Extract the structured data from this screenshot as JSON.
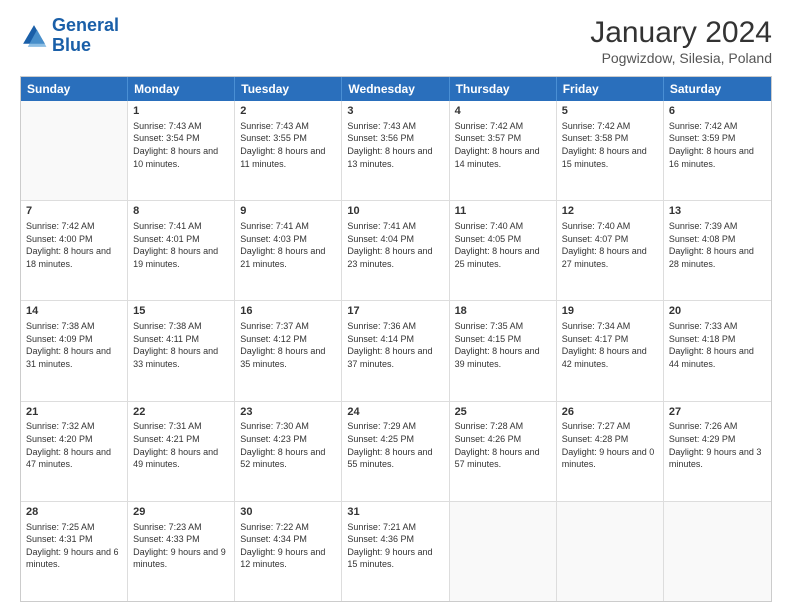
{
  "logo": {
    "line1": "General",
    "line2": "Blue"
  },
  "title": "January 2024",
  "subtitle": "Pogwizdow, Silesia, Poland",
  "header_days": [
    "Sunday",
    "Monday",
    "Tuesday",
    "Wednesday",
    "Thursday",
    "Friday",
    "Saturday"
  ],
  "weeks": [
    [
      {
        "day": "",
        "empty": true
      },
      {
        "day": "1",
        "sunrise": "Sunrise: 7:43 AM",
        "sunset": "Sunset: 3:54 PM",
        "daylight": "Daylight: 8 hours and 10 minutes."
      },
      {
        "day": "2",
        "sunrise": "Sunrise: 7:43 AM",
        "sunset": "Sunset: 3:55 PM",
        "daylight": "Daylight: 8 hours and 11 minutes."
      },
      {
        "day": "3",
        "sunrise": "Sunrise: 7:43 AM",
        "sunset": "Sunset: 3:56 PM",
        "daylight": "Daylight: 8 hours and 13 minutes."
      },
      {
        "day": "4",
        "sunrise": "Sunrise: 7:42 AM",
        "sunset": "Sunset: 3:57 PM",
        "daylight": "Daylight: 8 hours and 14 minutes."
      },
      {
        "day": "5",
        "sunrise": "Sunrise: 7:42 AM",
        "sunset": "Sunset: 3:58 PM",
        "daylight": "Daylight: 8 hours and 15 minutes."
      },
      {
        "day": "6",
        "sunrise": "Sunrise: 7:42 AM",
        "sunset": "Sunset: 3:59 PM",
        "daylight": "Daylight: 8 hours and 16 minutes."
      }
    ],
    [
      {
        "day": "7",
        "sunrise": "Sunrise: 7:42 AM",
        "sunset": "Sunset: 4:00 PM",
        "daylight": "Daylight: 8 hours and 18 minutes."
      },
      {
        "day": "8",
        "sunrise": "Sunrise: 7:41 AM",
        "sunset": "Sunset: 4:01 PM",
        "daylight": "Daylight: 8 hours and 19 minutes."
      },
      {
        "day": "9",
        "sunrise": "Sunrise: 7:41 AM",
        "sunset": "Sunset: 4:03 PM",
        "daylight": "Daylight: 8 hours and 21 minutes."
      },
      {
        "day": "10",
        "sunrise": "Sunrise: 7:41 AM",
        "sunset": "Sunset: 4:04 PM",
        "daylight": "Daylight: 8 hours and 23 minutes."
      },
      {
        "day": "11",
        "sunrise": "Sunrise: 7:40 AM",
        "sunset": "Sunset: 4:05 PM",
        "daylight": "Daylight: 8 hours and 25 minutes."
      },
      {
        "day": "12",
        "sunrise": "Sunrise: 7:40 AM",
        "sunset": "Sunset: 4:07 PM",
        "daylight": "Daylight: 8 hours and 27 minutes."
      },
      {
        "day": "13",
        "sunrise": "Sunrise: 7:39 AM",
        "sunset": "Sunset: 4:08 PM",
        "daylight": "Daylight: 8 hours and 28 minutes."
      }
    ],
    [
      {
        "day": "14",
        "sunrise": "Sunrise: 7:38 AM",
        "sunset": "Sunset: 4:09 PM",
        "daylight": "Daylight: 8 hours and 31 minutes."
      },
      {
        "day": "15",
        "sunrise": "Sunrise: 7:38 AM",
        "sunset": "Sunset: 4:11 PM",
        "daylight": "Daylight: 8 hours and 33 minutes."
      },
      {
        "day": "16",
        "sunrise": "Sunrise: 7:37 AM",
        "sunset": "Sunset: 4:12 PM",
        "daylight": "Daylight: 8 hours and 35 minutes."
      },
      {
        "day": "17",
        "sunrise": "Sunrise: 7:36 AM",
        "sunset": "Sunset: 4:14 PM",
        "daylight": "Daylight: 8 hours and 37 minutes."
      },
      {
        "day": "18",
        "sunrise": "Sunrise: 7:35 AM",
        "sunset": "Sunset: 4:15 PM",
        "daylight": "Daylight: 8 hours and 39 minutes."
      },
      {
        "day": "19",
        "sunrise": "Sunrise: 7:34 AM",
        "sunset": "Sunset: 4:17 PM",
        "daylight": "Daylight: 8 hours and 42 minutes."
      },
      {
        "day": "20",
        "sunrise": "Sunrise: 7:33 AM",
        "sunset": "Sunset: 4:18 PM",
        "daylight": "Daylight: 8 hours and 44 minutes."
      }
    ],
    [
      {
        "day": "21",
        "sunrise": "Sunrise: 7:32 AM",
        "sunset": "Sunset: 4:20 PM",
        "daylight": "Daylight: 8 hours and 47 minutes."
      },
      {
        "day": "22",
        "sunrise": "Sunrise: 7:31 AM",
        "sunset": "Sunset: 4:21 PM",
        "daylight": "Daylight: 8 hours and 49 minutes."
      },
      {
        "day": "23",
        "sunrise": "Sunrise: 7:30 AM",
        "sunset": "Sunset: 4:23 PM",
        "daylight": "Daylight: 8 hours and 52 minutes."
      },
      {
        "day": "24",
        "sunrise": "Sunrise: 7:29 AM",
        "sunset": "Sunset: 4:25 PM",
        "daylight": "Daylight: 8 hours and 55 minutes."
      },
      {
        "day": "25",
        "sunrise": "Sunrise: 7:28 AM",
        "sunset": "Sunset: 4:26 PM",
        "daylight": "Daylight: 8 hours and 57 minutes."
      },
      {
        "day": "26",
        "sunrise": "Sunrise: 7:27 AM",
        "sunset": "Sunset: 4:28 PM",
        "daylight": "Daylight: 9 hours and 0 minutes."
      },
      {
        "day": "27",
        "sunrise": "Sunrise: 7:26 AM",
        "sunset": "Sunset: 4:29 PM",
        "daylight": "Daylight: 9 hours and 3 minutes."
      }
    ],
    [
      {
        "day": "28",
        "sunrise": "Sunrise: 7:25 AM",
        "sunset": "Sunset: 4:31 PM",
        "daylight": "Daylight: 9 hours and 6 minutes."
      },
      {
        "day": "29",
        "sunrise": "Sunrise: 7:23 AM",
        "sunset": "Sunset: 4:33 PM",
        "daylight": "Daylight: 9 hours and 9 minutes."
      },
      {
        "day": "30",
        "sunrise": "Sunrise: 7:22 AM",
        "sunset": "Sunset: 4:34 PM",
        "daylight": "Daylight: 9 hours and 12 minutes."
      },
      {
        "day": "31",
        "sunrise": "Sunrise: 7:21 AM",
        "sunset": "Sunset: 4:36 PM",
        "daylight": "Daylight: 9 hours and 15 minutes."
      },
      {
        "day": "",
        "empty": true
      },
      {
        "day": "",
        "empty": true
      },
      {
        "day": "",
        "empty": true
      }
    ]
  ]
}
